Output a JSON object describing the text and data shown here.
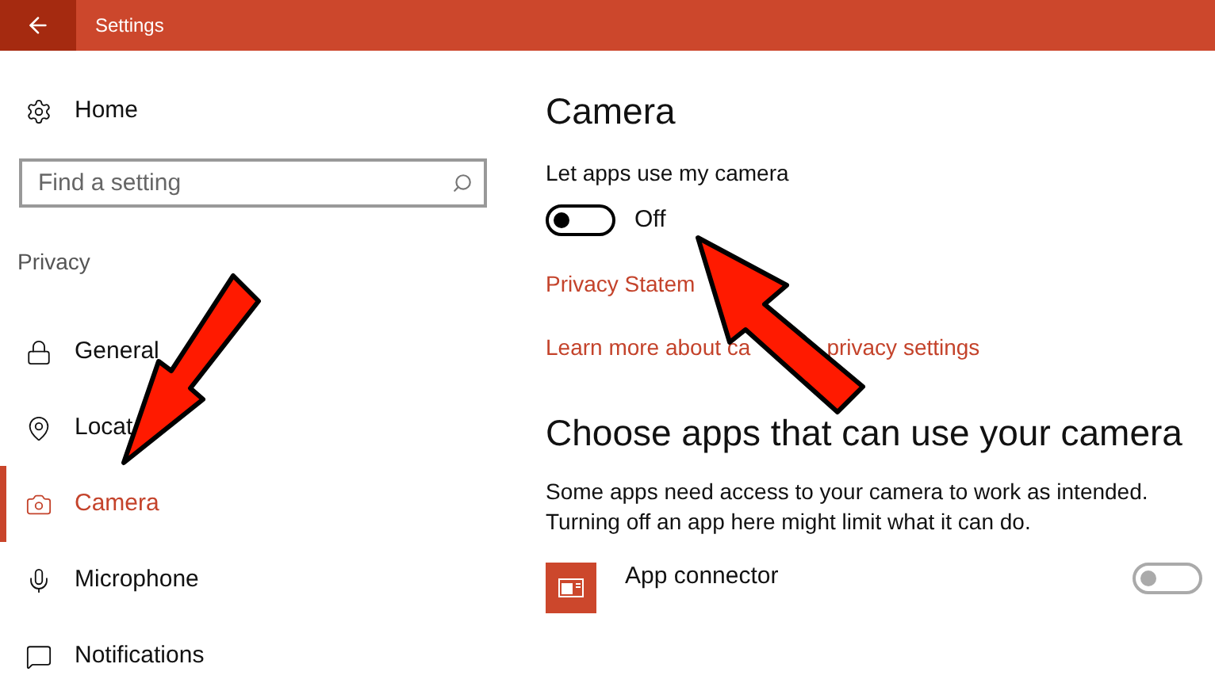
{
  "title_bar": {
    "title": "Settings"
  },
  "sidebar": {
    "home": "Home",
    "search": {
      "placeholder": "Find a setting"
    },
    "section": "Privacy",
    "items": [
      {
        "label": "General",
        "selected": false
      },
      {
        "label": "Locat",
        "selected": false
      },
      {
        "label": "Camera",
        "selected": true
      },
      {
        "label": "Microphone",
        "selected": false
      },
      {
        "label": "Notifications",
        "selected": false
      }
    ]
  },
  "main": {
    "heading": "Camera",
    "setting_label": "Let apps use my camera",
    "toggle": {
      "on": false,
      "label": "Off"
    },
    "links": [
      {
        "parts": [
          "Privacy Statem"
        ]
      },
      {
        "parts": [
          "Learn more about ca",
          "privacy settings"
        ]
      }
    ],
    "apps_heading": "Choose apps that can use your camera",
    "apps_description": "Some apps need access to your camera to work as intended. Turning off an app here might limit what it can do.",
    "apps": [
      {
        "name": "App connector",
        "on": false
      }
    ]
  }
}
